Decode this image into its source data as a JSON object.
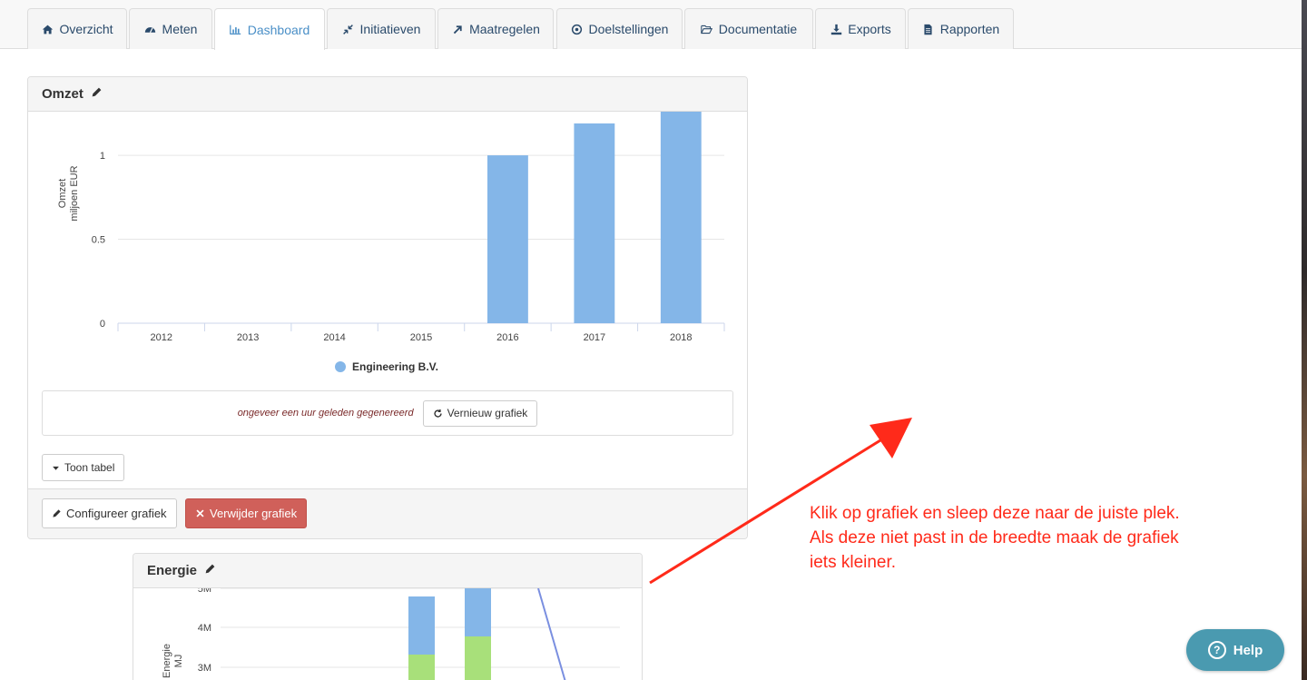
{
  "tabs": [
    {
      "label": "Overzicht",
      "icon": "home-icon"
    },
    {
      "label": "Meten",
      "icon": "dashboard-gauge-icon"
    },
    {
      "label": "Dashboard",
      "icon": "bar-chart-icon",
      "active": true
    },
    {
      "label": "Initiatieven",
      "icon": "compress-arrows-icon"
    },
    {
      "label": "Maatregelen",
      "icon": "arrow-up-right-icon"
    },
    {
      "label": "Doelstellingen",
      "icon": "target-icon"
    },
    {
      "label": "Documentatie",
      "icon": "folder-open-icon"
    },
    {
      "label": "Exports",
      "icon": "download-icon"
    },
    {
      "label": "Rapporten",
      "icon": "file-text-icon"
    }
  ],
  "omzet_panel": {
    "title": "Omzet",
    "generated_text": "ongeveer een uur geleden gegenereerd",
    "refresh_label": "Vernieuw grafiek",
    "toggle_table_label": "Toon tabel",
    "configure_label": "Configureer grafiek",
    "delete_label": "Verwijder grafiek"
  },
  "energie_panel": {
    "title": "Energie"
  },
  "annotation": {
    "lines": [
      "Klik op grafiek en sleep deze naar de juiste plek.",
      "Als deze niet past in de breedte maak de grafiek",
      "iets kleiner."
    ],
    "color": "#ff2a1a"
  },
  "help_label": "Help",
  "chart_data": [
    {
      "type": "bar",
      "ylabel": "Omzet",
      "ylabel_unit": "miljoen EUR",
      "categories": [
        "2012",
        "2013",
        "2014",
        "2015",
        "2016",
        "2017",
        "2018"
      ],
      "series": [
        {
          "name": "Engineering B.V.",
          "values": [
            null,
            null,
            null,
            null,
            1.0,
            1.19,
            1.26
          ],
          "color": "#84b6e8"
        }
      ],
      "yticks": [
        "0",
        "0.5",
        "1"
      ],
      "ylim": [
        0,
        1.26
      ],
      "grid": true,
      "legend": "bottom"
    },
    {
      "type": "bar",
      "ylabel": "Energie",
      "ylabel_unit": "MJ",
      "yticks": [
        "3M",
        "4M",
        "5M"
      ],
      "series_colors": [
        "#84b6e8",
        "#a8e07a",
        "#7a8fe0"
      ],
      "legend": "none"
    }
  ]
}
